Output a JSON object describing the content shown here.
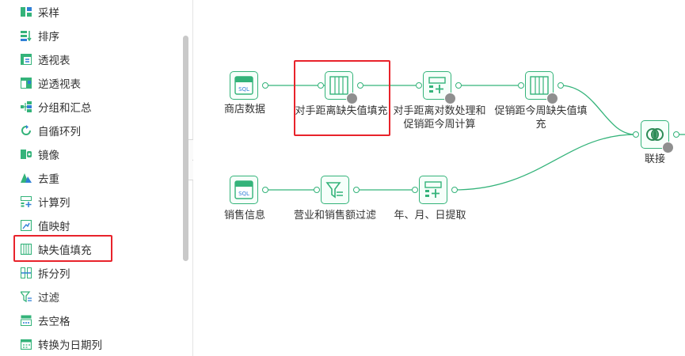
{
  "sidebar": {
    "items": [
      {
        "label": "采样",
        "icon": "sample-icon"
      },
      {
        "label": "排序",
        "icon": "sort-icon"
      },
      {
        "label": "透视表",
        "icon": "pivot-icon"
      },
      {
        "label": "逆透视表",
        "icon": "unpivot-icon"
      },
      {
        "label": "分组和汇总",
        "icon": "group-icon"
      },
      {
        "label": "自循环列",
        "icon": "loop-icon"
      },
      {
        "label": "镜像",
        "icon": "mirror-icon"
      },
      {
        "label": "去重",
        "icon": "dedupe-icon"
      },
      {
        "label": "计算列",
        "icon": "calc-column-icon"
      },
      {
        "label": "值映射",
        "icon": "value-map-icon"
      },
      {
        "label": "缺失值填充",
        "icon": "missing-fill-icon"
      },
      {
        "label": "拆分列",
        "icon": "split-column-icon"
      },
      {
        "label": "过滤",
        "icon": "filter-icon"
      },
      {
        "label": "去空格",
        "icon": "trim-icon"
      },
      {
        "label": "转换为日期列",
        "icon": "to-date-icon"
      }
    ],
    "selected_label": "缺失值填充",
    "collapse_glyph": "‹"
  },
  "canvas": {
    "nodes": [
      {
        "id": "shop-data",
        "label": "商店数据",
        "icon": "sql-icon"
      },
      {
        "id": "fill-competitor-distance",
        "label": "对手距离缺失值填充",
        "icon": "missing-fill-icon"
      },
      {
        "id": "log-transform",
        "label": "对手距离对数处理和促销距今周计算",
        "icon": "calc-column-icon"
      },
      {
        "id": "fill-promo-weeks",
        "label": "促销距今周缺失值填充",
        "icon": "missing-fill-icon"
      },
      {
        "id": "join",
        "label": "联接",
        "icon": "join-icon"
      },
      {
        "id": "sales-info",
        "label": "销售信息",
        "icon": "sql-icon"
      },
      {
        "id": "sales-filter",
        "label": "营业和销售额过滤",
        "icon": "filter-icon"
      },
      {
        "id": "date-extract",
        "label": "年、月、日提取",
        "icon": "calc-column-icon"
      }
    ],
    "highlighted_node": "对手距离缺失值填充"
  },
  "colors": {
    "accent": "#34b37a",
    "highlight": "#e8232b",
    "badge": "#8f8f8f"
  }
}
